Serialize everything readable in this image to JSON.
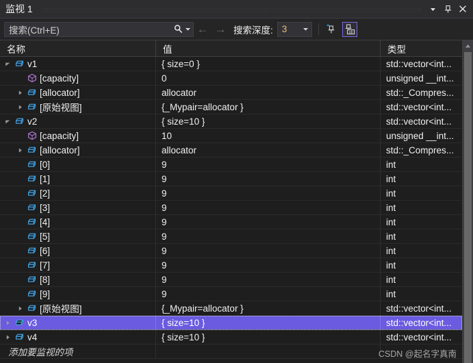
{
  "window": {
    "title": "监视 1",
    "dropdown_icon": "chevron-down-icon",
    "pin_icon": "pin-icon",
    "close_icon": "close-icon"
  },
  "toolbar": {
    "search_placeholder": "搜索(Ctrl+E)",
    "search_icon": "search-icon",
    "search_dropdown_icon": "chevron-down-icon",
    "back_arrow": "←",
    "forward_arrow": "→",
    "depth_label": "搜索深度:",
    "depth_value": "3",
    "depth_dropdown_icon": "chevron-down-icon",
    "pin_tool_icon": "pin-filter-icon",
    "hex_tool_icon": "show-value-ab-icon",
    "hex_tool_active": true
  },
  "grid": {
    "columns": [
      "名称",
      "值",
      "类型"
    ],
    "rows": [
      {
        "indent": 0,
        "twisty": "expanded",
        "icon": "variable-icon",
        "name": "v1",
        "value": "{ size=0 }",
        "type": "std::vector<int..."
      },
      {
        "indent": 1,
        "twisty": "none",
        "icon": "field-icon",
        "name": "[capacity]",
        "value": "0",
        "type": "unsigned __int..."
      },
      {
        "indent": 1,
        "twisty": "collapsed",
        "icon": "variable-icon",
        "name": "[allocator]",
        "value": "allocator",
        "type": "std::_Compres..."
      },
      {
        "indent": 1,
        "twisty": "collapsed",
        "icon": "variable-icon",
        "name": "[原始视图]",
        "value": "{_Mypair=allocator }",
        "type": "std::vector<int..."
      },
      {
        "indent": 0,
        "twisty": "expanded",
        "icon": "variable-icon",
        "name": "v2",
        "value": "{ size=10 }",
        "type": "std::vector<int..."
      },
      {
        "indent": 1,
        "twisty": "none",
        "icon": "field-icon",
        "name": "[capacity]",
        "value": "10",
        "type": "unsigned __int..."
      },
      {
        "indent": 1,
        "twisty": "collapsed",
        "icon": "variable-icon",
        "name": "[allocator]",
        "value": "allocator",
        "type": "std::_Compres..."
      },
      {
        "indent": 1,
        "twisty": "none",
        "icon": "variable-icon",
        "name": "[0]",
        "value": "9",
        "type": "int"
      },
      {
        "indent": 1,
        "twisty": "none",
        "icon": "variable-icon",
        "name": "[1]",
        "value": "9",
        "type": "int"
      },
      {
        "indent": 1,
        "twisty": "none",
        "icon": "variable-icon",
        "name": "[2]",
        "value": "9",
        "type": "int"
      },
      {
        "indent": 1,
        "twisty": "none",
        "icon": "variable-icon",
        "name": "[3]",
        "value": "9",
        "type": "int"
      },
      {
        "indent": 1,
        "twisty": "none",
        "icon": "variable-icon",
        "name": "[4]",
        "value": "9",
        "type": "int"
      },
      {
        "indent": 1,
        "twisty": "none",
        "icon": "variable-icon",
        "name": "[5]",
        "value": "9",
        "type": "int"
      },
      {
        "indent": 1,
        "twisty": "none",
        "icon": "variable-icon",
        "name": "[6]",
        "value": "9",
        "type": "int"
      },
      {
        "indent": 1,
        "twisty": "none",
        "icon": "variable-icon",
        "name": "[7]",
        "value": "9",
        "type": "int"
      },
      {
        "indent": 1,
        "twisty": "none",
        "icon": "variable-icon",
        "name": "[8]",
        "value": "9",
        "type": "int"
      },
      {
        "indent": 1,
        "twisty": "none",
        "icon": "variable-icon",
        "name": "[9]",
        "value": "9",
        "type": "int"
      },
      {
        "indent": 1,
        "twisty": "collapsed",
        "icon": "variable-icon",
        "name": "[原始视图]",
        "value": "{_Mypair=allocator }",
        "type": "std::vector<int..."
      },
      {
        "indent": 0,
        "twisty": "collapsed",
        "icon": "variable-icon",
        "name": "v3",
        "value": "{ size=10 }",
        "type": "std::vector<int...",
        "selected": true
      },
      {
        "indent": 0,
        "twisty": "collapsed",
        "icon": "variable-icon",
        "name": "v4",
        "value": "{ size=10 }",
        "type": "std::vector<int..."
      }
    ],
    "add_item_placeholder": "添加要监视的项"
  },
  "watermark": "CSDN @起名字真南",
  "colors": {
    "selection": "#6a5be0",
    "accent_icon": "#3f9fe0",
    "field_icon": "#a673c8",
    "depth_value": "#e8c07a",
    "window_bg": "#1e1e1e",
    "chrome_bg": "#2d2d30"
  }
}
